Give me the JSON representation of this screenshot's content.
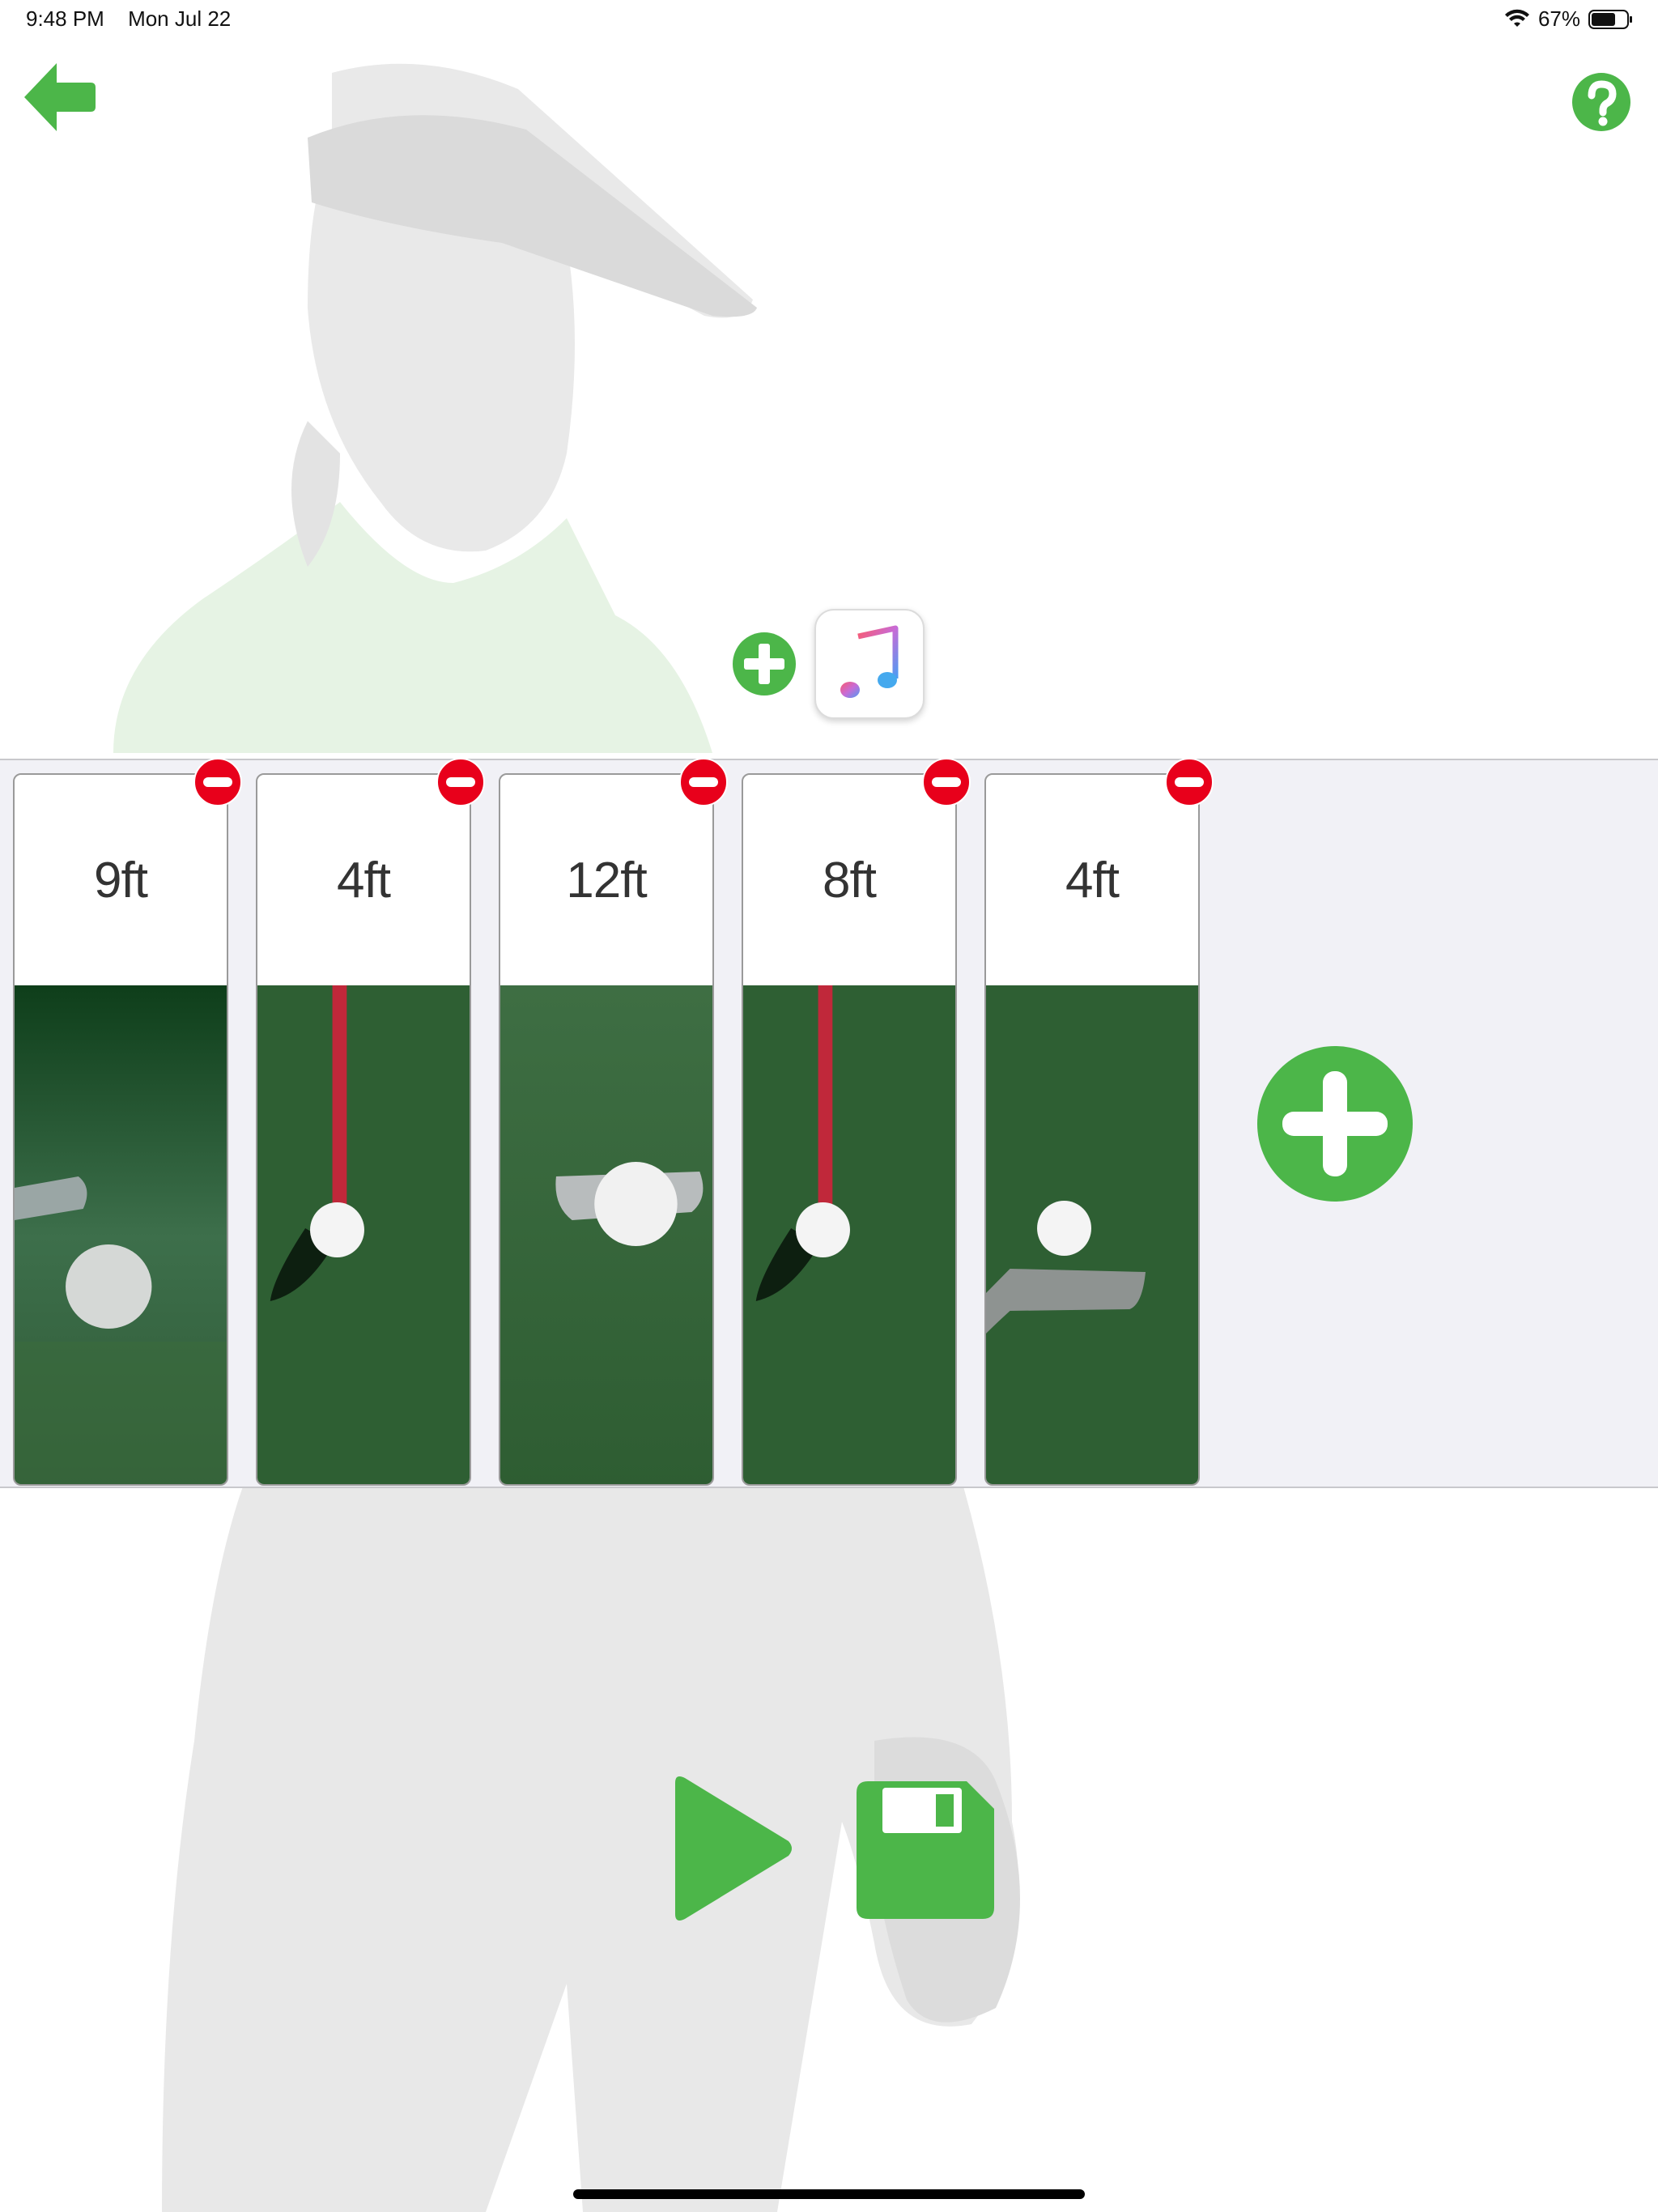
{
  "status_bar": {
    "time": "9:48 PM",
    "date": "Mon Jul 22",
    "battery_percent": "67%",
    "battery_level": 0.67
  },
  "colors": {
    "accent_green": "#4cb649",
    "remove_red": "#e8001b",
    "strip_background": "#f1f1f6"
  },
  "icons": {
    "back": "back-arrow-icon",
    "help": "question-mark-icon",
    "music_add": "plus-circle-icon",
    "music": "apple-music-icon",
    "remove": "minus-circle-icon",
    "add_clip": "plus-circle-icon",
    "play": "play-icon",
    "save": "floppy-disk-icon"
  },
  "clips": [
    {
      "label": "9ft",
      "thumbnail": "ball-rolling-putter-left"
    },
    {
      "label": "4ft",
      "thumbnail": "ball-at-red-flagstick"
    },
    {
      "label": "12ft",
      "thumbnail": "ball-on-putter-face"
    },
    {
      "label": "8ft",
      "thumbnail": "ball-at-red-flagstick"
    },
    {
      "label": "4ft",
      "thumbnail": "ball-behind-putter"
    }
  ]
}
